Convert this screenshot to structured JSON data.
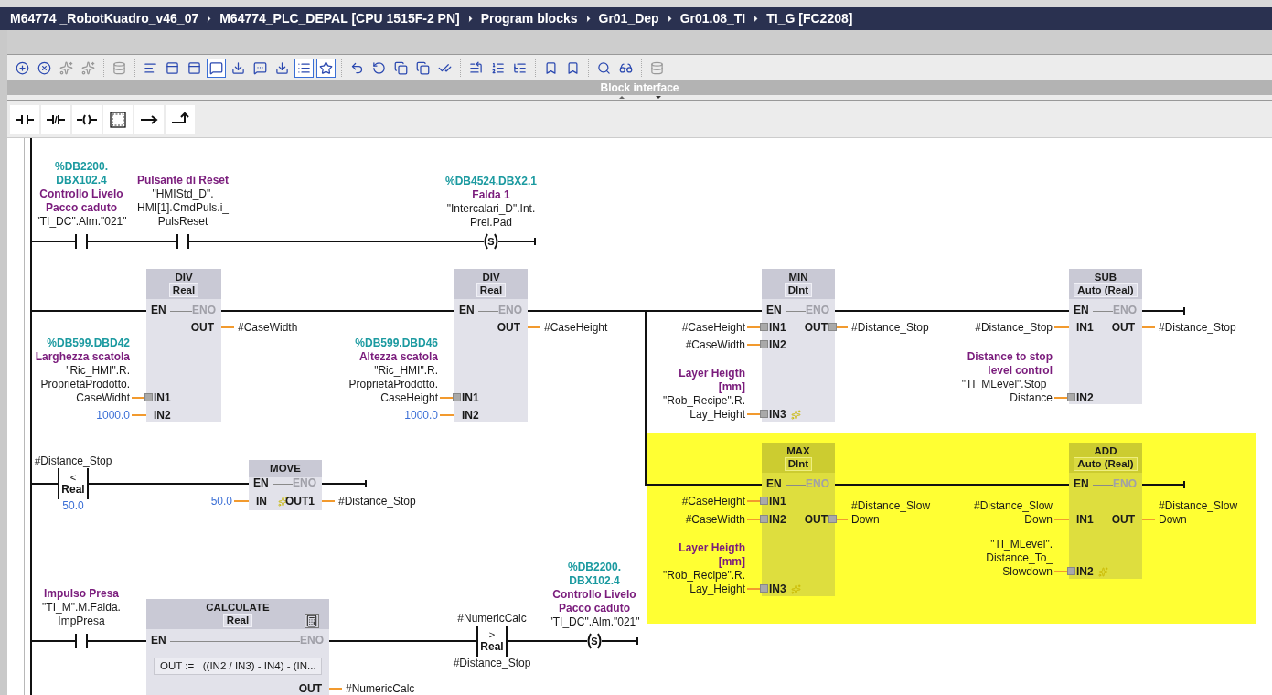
{
  "breadcrumb": [
    "M64774 _RobotKuadro_v46_07",
    "M64774_PLC_DEPAL [CPU 1515F-2 PN]",
    "Program blocks",
    "Gr01_Dep",
    "Gr01.08_TI",
    "TI_G [FC2208]"
  ],
  "toolbar": [
    {
      "selected": false
    },
    {
      "selected": false
    },
    {
      "selected": false
    },
    {
      "selected": false
    },
    {
      "selected": false
    },
    {
      "selected": false
    },
    {
      "selected": false
    },
    {
      "selected": false
    },
    {
      "selected": true
    },
    {
      "selected": false
    },
    {
      "selected": false
    },
    {
      "selected": false
    },
    {
      "selected": true
    },
    {
      "selected": true
    },
    {
      "selected": false
    },
    {
      "selected": false
    },
    {
      "selected": false
    },
    {
      "selected": false
    },
    {
      "selected": false
    },
    {
      "selected": false
    },
    {
      "selected": false
    },
    {
      "selected": false
    },
    {
      "selected": false
    },
    {
      "selected": false
    },
    {
      "selected": false
    },
    {
      "selected": false
    },
    {
      "selected": false
    }
  ],
  "panel_title": "Block interface",
  "networks": [
    {
      "rungs": [
        {
          "highlighted": false,
          "elements": [
            {
              "kind": "contact",
              "address": [
                "%DB2200.",
                "DBX102.4"
              ],
              "comment": [
                "Controllo Livelo",
                "Pacco caduto"
              ],
              "operand": [
                "\"TI_DC\".Alm.\"021\""
              ]
            },
            {
              "kind": "contact",
              "comment": [
                "Pulsante di Reset"
              ],
              "operand": [
                "\"HMIStd_D\".",
                "HMI[1].CmdPuls.i_",
                "PulsReset"
              ]
            },
            {
              "kind": "coil",
              "coil": "S",
              "address": [
                "%DB4524.DBX2.1"
              ],
              "comment": [
                "Falda 1"
              ],
              "operand": [
                "\"Intercalari_D\".Int.",
                "Prel.Pad"
              ]
            }
          ]
        }
      ]
    },
    {
      "rungs": [
        {
          "highlighted": false,
          "elements": [
            {
              "kind": "box",
              "name": "DIV",
              "type": "Real",
              "en": "EN",
              "eno": "ENO",
              "inputs": [
                {
                  "pin": "IN1",
                  "marker": true,
                  "star": false,
                  "literal": false,
                  "address": [
                    "%DB599.DBD42"
                  ],
                  "comment": [
                    "Larghezza scatola"
                  ],
                  "operand": [
                    "\"Ric_HMI\".R.",
                    "ProprietàProdotto.",
                    "CaseWidht"
                  ]
                },
                {
                  "pin": "IN2",
                  "marker": false,
                  "star": false,
                  "literal": true,
                  "operand": [
                    "1000.0"
                  ]
                }
              ],
              "outputs": [
                {
                  "pin": "OUT",
                  "marker": false,
                  "operand": [
                    "#CaseWidth"
                  ]
                }
              ]
            },
            {
              "kind": "box",
              "name": "DIV",
              "type": "Real",
              "en": "EN",
              "eno": "ENO",
              "inputs": [
                {
                  "pin": "IN1",
                  "marker": true,
                  "star": false,
                  "literal": false,
                  "address": [
                    "%DB599.DBD46"
                  ],
                  "comment": [
                    "Altezza scatola"
                  ],
                  "operand": [
                    "\"Ric_HMI\".R.",
                    "ProprietàProdotto.",
                    "CaseHeight"
                  ]
                },
                {
                  "pin": "IN2",
                  "marker": false,
                  "star": false,
                  "literal": true,
                  "operand": [
                    "1000.0"
                  ]
                }
              ],
              "outputs": [
                {
                  "pin": "OUT",
                  "marker": false,
                  "operand": [
                    "#CaseHeight"
                  ]
                }
              ]
            },
            {
              "kind": "box",
              "name": "MIN",
              "type": "DInt",
              "en": "EN",
              "eno": "ENO",
              "inputs": [
                {
                  "pin": "IN1",
                  "marker": true,
                  "star": false,
                  "literal": false,
                  "operand": [
                    "#CaseHeight"
                  ]
                },
                {
                  "pin": "IN2",
                  "marker": true,
                  "star": false,
                  "literal": false,
                  "operand": [
                    "#CaseWidth"
                  ]
                },
                {
                  "pin": "IN3",
                  "marker": true,
                  "star": true,
                  "literal": false,
                  "comment": [
                    "Layer Heigth",
                    "[mm]"
                  ],
                  "operand": [
                    "\"Rob_Recipe\".R.",
                    "Lay_Height"
                  ]
                }
              ],
              "outputs": [
                {
                  "pin": "OUT",
                  "marker": true,
                  "operand": [
                    "#Distance_Stop"
                  ]
                }
              ]
            },
            {
              "kind": "box",
              "name": "SUB",
              "type": "Auto (Real)",
              "en": "EN",
              "eno": "ENO",
              "inputs": [
                {
                  "pin": "IN1",
                  "marker": false,
                  "star": false,
                  "literal": false,
                  "operand": [
                    "#Distance_Stop"
                  ]
                },
                {
                  "pin": "IN2",
                  "marker": true,
                  "star": false,
                  "literal": false,
                  "comment": [
                    "Distance to stop",
                    "level control"
                  ],
                  "operand": [
                    "\"TI_MLevel\".Stop_",
                    "Distance"
                  ]
                }
              ],
              "outputs": [
                {
                  "pin": "OUT",
                  "marker": false,
                  "operand": [
                    "#Distance_Stop"
                  ]
                }
              ]
            }
          ]
        },
        {
          "highlighted": true,
          "elements": [
            {
              "kind": "box",
              "name": "MAX",
              "type": "DInt",
              "en": "EN",
              "eno": "ENO",
              "inputs": [
                {
                  "pin": "IN1",
                  "marker": true,
                  "star": false,
                  "literal": false,
                  "operand": [
                    "#CaseHeight"
                  ]
                },
                {
                  "pin": "IN2",
                  "marker": true,
                  "star": false,
                  "literal": false,
                  "operand": [
                    "#CaseWidth"
                  ]
                },
                {
                  "pin": "IN3",
                  "marker": true,
                  "star": true,
                  "literal": false,
                  "comment": [
                    "Layer Heigth",
                    "[mm]"
                  ],
                  "operand": [
                    "\"Rob_Recipe\".R.",
                    "Lay_Height"
                  ]
                }
              ],
              "outputs": [
                {
                  "pin": "OUT",
                  "marker": true,
                  "operand": [
                    "#Distance_Slow",
                    "Down"
                  ]
                }
              ]
            },
            {
              "kind": "box",
              "name": "ADD",
              "type": "Auto (Real)",
              "en": "EN",
              "eno": "ENO",
              "inputs": [
                {
                  "pin": "IN1",
                  "marker": false,
                  "star": false,
                  "literal": false,
                  "operand": [
                    "#Distance_Slow",
                    "Down"
                  ]
                },
                {
                  "pin": "IN2",
                  "marker": true,
                  "star": true,
                  "literal": false,
                  "operand": [
                    "\"TI_MLevel\".",
                    "Distance_To_",
                    "Slowdown"
                  ]
                }
              ],
              "outputs": [
                {
                  "pin": "OUT",
                  "marker": false,
                  "operand": [
                    "#Distance_Slow",
                    "Down"
                  ]
                }
              ]
            }
          ]
        }
      ]
    },
    {
      "rungs": [
        {
          "highlighted": false,
          "elements": [
            {
              "kind": "compare",
              "operator": "<",
              "type": "Real",
              "top": {
                "literal": false,
                "operand": [
                  "#Distance_Stop"
                ]
              },
              "bottom": {
                "literal": true,
                "operand": [
                  "50.0"
                ]
              }
            },
            {
              "kind": "box",
              "name": "MOVE",
              "en": "EN",
              "eno": "ENO",
              "inputs": [
                {
                  "pin": "IN",
                  "marker": false,
                  "star": true,
                  "literal": true,
                  "operand": [
                    "50.0"
                  ]
                }
              ],
              "outputs": [
                {
                  "pin": "OUT1",
                  "marker": false,
                  "operand": [
                    "#Distance_Stop"
                  ]
                }
              ]
            }
          ]
        }
      ]
    },
    {
      "rungs": [
        {
          "highlighted": false,
          "elements": [
            {
              "kind": "contact",
              "comment": [
                "Impulso Presa"
              ],
              "operand": [
                "\"TI_M\".M.Falda.",
                "ImpPresa"
              ]
            },
            {
              "kind": "calculate",
              "name": "CALCULATE",
              "type": "Real",
              "en": "EN",
              "eno": "ENO",
              "expression": "OUT :=   ((IN2 / IN3) - IN4) - (IN...",
              "outputs": [
                {
                  "pin": "OUT",
                  "marker": false,
                  "operand": [
                    "#NumericCalc"
                  ]
                }
              ]
            },
            {
              "kind": "compare",
              "operator": ">",
              "type": "Real",
              "top": {
                "literal": false,
                "operand": [
                  "#NumericCalc"
                ]
              },
              "bottom": {
                "literal": false,
                "operand": [
                  "#Distance_Stop"
                ]
              }
            },
            {
              "kind": "coil",
              "coil": "S",
              "address": [
                "%DB2200.",
                "DBX102.4"
              ],
              "comment": [
                "Controllo Livelo",
                "Pacco caduto"
              ],
              "operand": [
                "\"TI_DC\".Alm.\"021\""
              ]
            }
          ]
        }
      ]
    }
  ]
}
